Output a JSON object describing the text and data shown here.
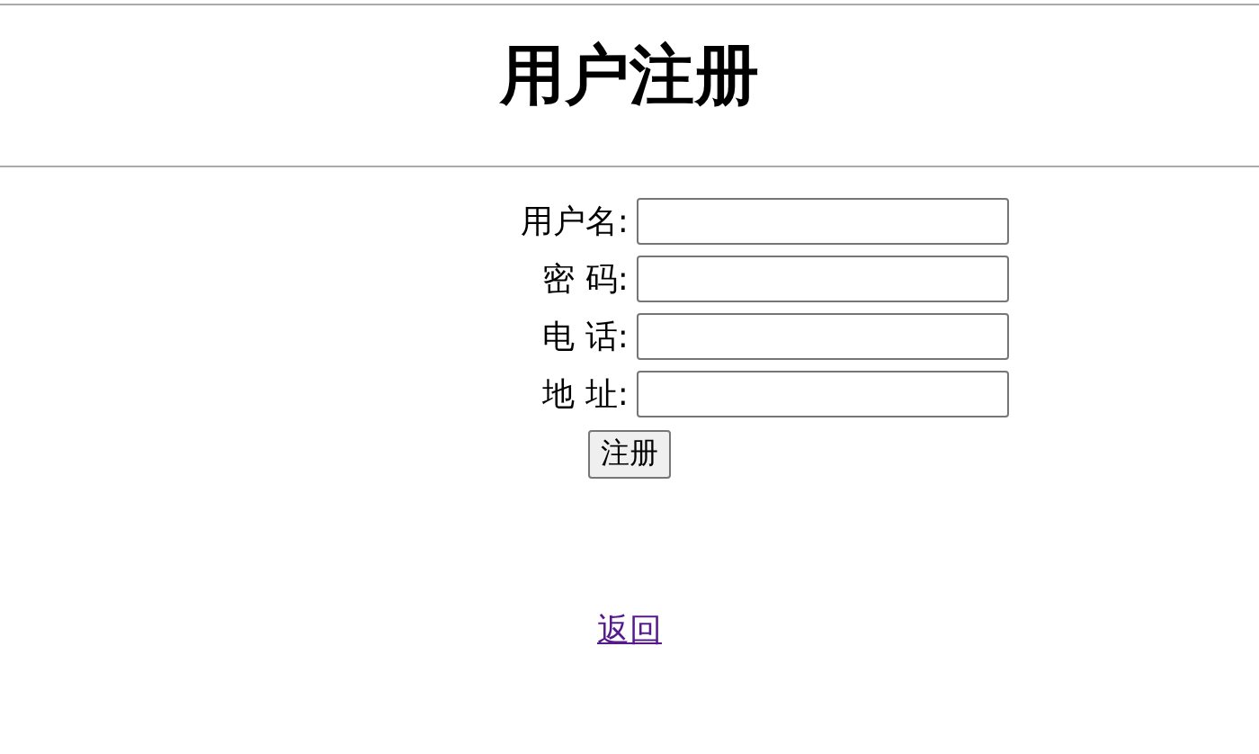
{
  "title": "用户注册",
  "fields": [
    {
      "label": "用户名:"
    },
    {
      "label": "密 码:"
    },
    {
      "label": "电 话:"
    },
    {
      "label": "地 址:"
    }
  ],
  "submit": "注册",
  "back_link": "返回"
}
